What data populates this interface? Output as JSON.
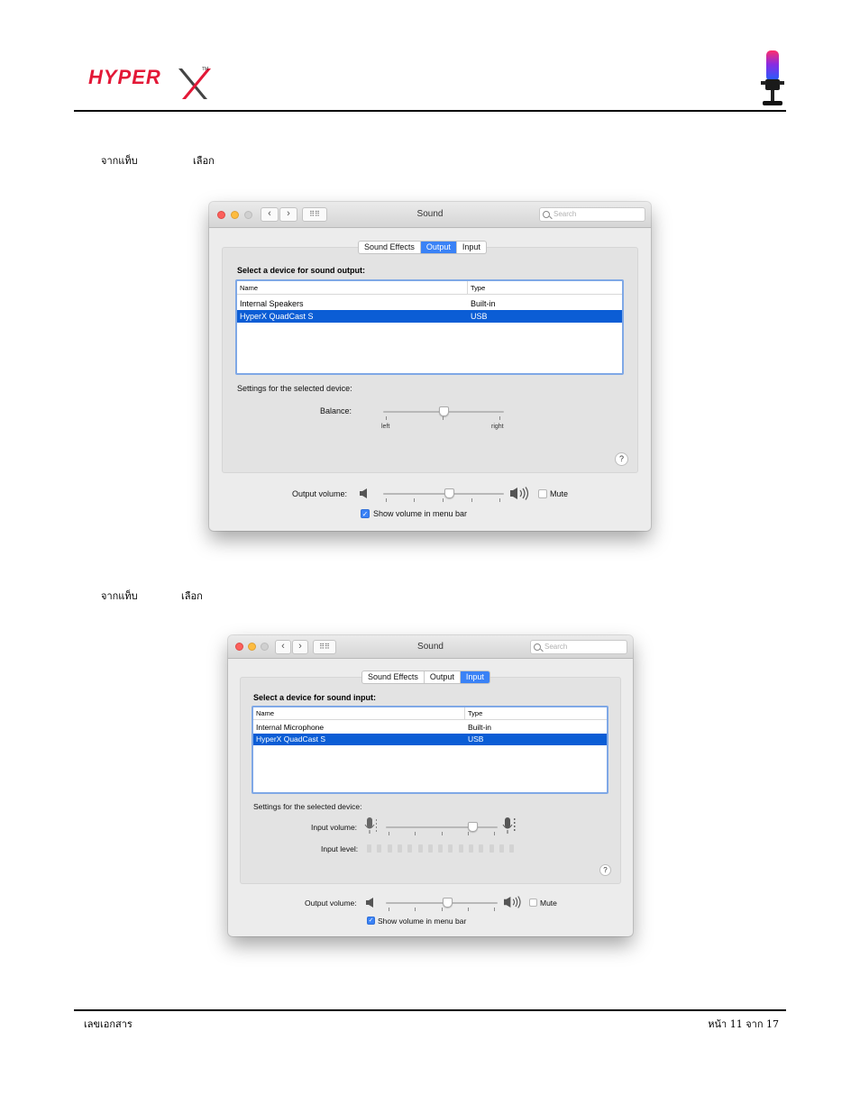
{
  "header": {
    "brand": "HyperX",
    "logo_text": "HYPER"
  },
  "instructions": [
    {
      "prefix": "จากแท็บ",
      "suffix": "เลือก"
    },
    {
      "prefix": "จากแท็บ",
      "suffix": "เลือก"
    }
  ],
  "windows": [
    {
      "title": "Sound",
      "search_placeholder": "Search",
      "tabs": [
        {
          "label": "Sound Effects",
          "active": false
        },
        {
          "label": "Output",
          "active": true
        },
        {
          "label": "Input",
          "active": false
        }
      ],
      "select_label": "Select a device for sound output:",
      "table": {
        "columns": [
          "Name",
          "Type"
        ],
        "rows": [
          {
            "name": "Internal Speakers",
            "type": "Built-in",
            "selected": false
          },
          {
            "name": "HyperX QuadCast S",
            "type": "USB",
            "selected": true
          }
        ]
      },
      "settings_label": "Settings for the selected device:",
      "balance": {
        "label": "Balance:",
        "left": "left",
        "right": "right",
        "value": 0.5
      },
      "output_volume": {
        "label": "Output volume:",
        "value": 0.55
      },
      "mute_label": "Mute",
      "show_volume_label": "Show volume in menu bar",
      "help": "?"
    },
    {
      "title": "Sound",
      "search_placeholder": "Search",
      "tabs": [
        {
          "label": "Sound Effects",
          "active": false
        },
        {
          "label": "Output",
          "active": false
        },
        {
          "label": "Input",
          "active": true
        }
      ],
      "select_label": "Select a device for sound input:",
      "table": {
        "columns": [
          "Name",
          "Type"
        ],
        "rows": [
          {
            "name": "Internal Microphone",
            "type": "Built-in",
            "selected": false
          },
          {
            "name": "HyperX QuadCast S",
            "type": "USB",
            "selected": true
          }
        ]
      },
      "settings_label": "Settings for the selected device:",
      "input_volume": {
        "label": "Input volume:",
        "value": 0.78
      },
      "input_level": {
        "label": "Input level:",
        "segments": 15,
        "lit": 0
      },
      "output_volume": {
        "label": "Output volume:",
        "value": 0.55
      },
      "mute_label": "Mute",
      "show_volume_label": "Show volume in menu bar",
      "help": "?"
    }
  ],
  "footer": {
    "left": "เลขเอกสาร",
    "right": "หน้า 11 จาก 17"
  }
}
